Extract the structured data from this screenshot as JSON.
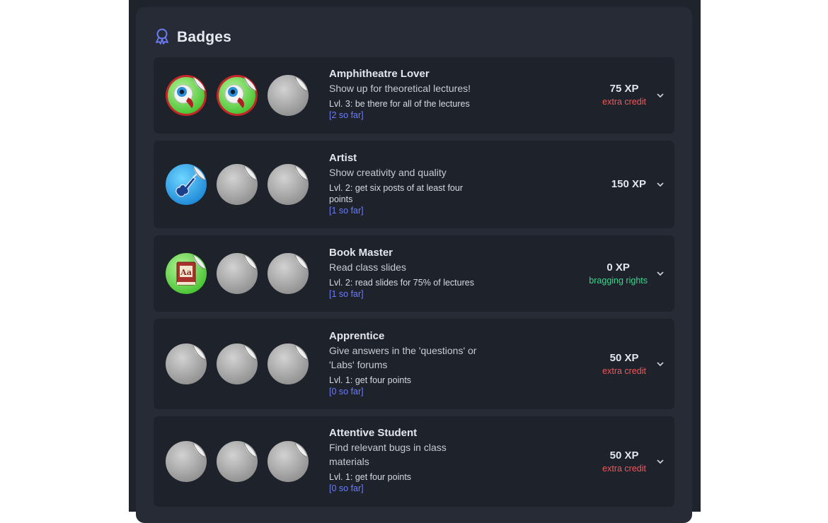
{
  "header": {
    "title": "Badges",
    "icon": "badge-ribbon-icon"
  },
  "colors": {
    "accent": "#6c7cf7",
    "extra_credit": "#f0585a",
    "bragging": "#3dd68c"
  },
  "badges": [
    {
      "name": "Amphitheatre Lover",
      "description": "Show up for theoretical lectures!",
      "level_text": "Lvl. 3: be there for all of the lectures",
      "progress": "[2 so far]",
      "xp": "75 XP",
      "note": "extra credit",
      "icons": [
        "eyeball-badge-icon",
        "eyeball-badge-icon",
        "locked-badge-icon"
      ]
    },
    {
      "name": "Artist",
      "description": "Show creativity and quality",
      "level_text": "Lvl. 2: get six posts of at least four points",
      "progress": "[1 so far]",
      "xp": "150 XP",
      "note": "",
      "icons": [
        "guitar-badge-icon",
        "locked-badge-icon",
        "locked-badge-icon"
      ]
    },
    {
      "name": "Book Master",
      "description": "Read class slides",
      "level_text": "Lvl. 2: read slides for 75% of lectures",
      "progress": "[1 so far]",
      "xp": "0 XP",
      "note": "bragging rights",
      "book_label": "Aa",
      "icons": [
        "book-badge-icon",
        "locked-badge-icon",
        "locked-badge-icon"
      ]
    },
    {
      "name": "Apprentice",
      "description": "Give answers in the 'questions' or 'Labs' forums",
      "level_text": "Lvl. 1: get four points",
      "progress": "[0 so far]",
      "xp": "50 XP",
      "note": "extra credit",
      "icons": [
        "locked-badge-icon",
        "locked-badge-icon",
        "locked-badge-icon"
      ]
    },
    {
      "name": "Attentive Student",
      "description": "Find relevant bugs in class materials",
      "level_text": "Lvl. 1: get four points",
      "progress": "[0 so far]",
      "xp": "50 XP",
      "note": "extra credit",
      "icons": [
        "locked-badge-icon",
        "locked-badge-icon",
        "locked-badge-icon"
      ]
    }
  ]
}
